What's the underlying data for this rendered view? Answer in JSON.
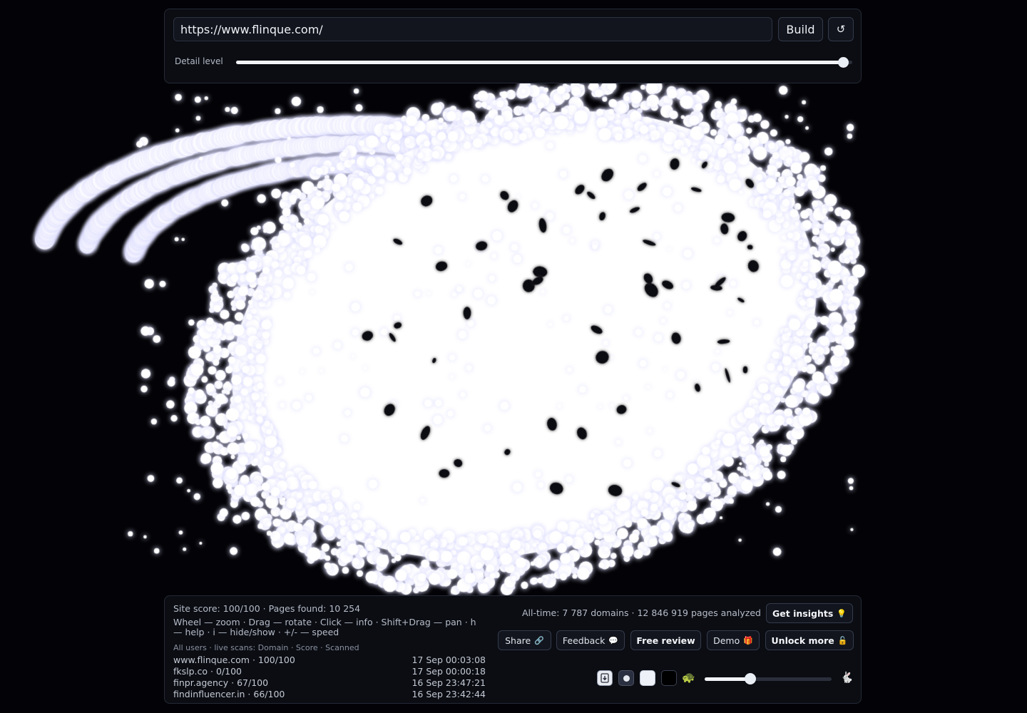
{
  "builder": {
    "url_value": "https://www.flinque.com/",
    "build_label": "Build",
    "reset_symbol": "↺",
    "detail_label": "Detail level",
    "detail_level": 0.985
  },
  "stats": {
    "site_score_line": "Site score: 100/100 · Pages found: 10 254",
    "help_text": "Wheel — zoom · Drag — rotate · Click — info · Shift+Drag — pan · h — help · i — hide/show · +/- — speed",
    "alltime_text": "All-time: 7 787 domains · 12 846 919 pages analyzed",
    "scans_header": "All users · live scans: Domain · Score · Scanned",
    "scans": [
      {
        "domain": "www.flinque.com · 100/100",
        "time": "17 Sep 00:03:08"
      },
      {
        "domain": "fkslp.co · 0/100",
        "time": "17 Sep 00:00:18"
      },
      {
        "domain": "finpr.agency · 67/100",
        "time": "16 Sep 23:47:21"
      },
      {
        "domain": "findinfluencer.in · 66/100",
        "time": "16 Sep 23:42:44"
      }
    ]
  },
  "actions": {
    "insights_label": "Get insights",
    "insights_emoji": "💡",
    "share_label": "Share",
    "share_emoji": "🔗",
    "feedback_label": "Feedback",
    "feedback_emoji": "💬",
    "free_review_label": "Free review",
    "demo_label": "Demo",
    "demo_emoji": "🎁",
    "unlock_label": "Unlock more",
    "unlock_emoji": "🔓"
  },
  "controls": {
    "turtle_glyph": "🐢",
    "rabbit_glyph": "🐇",
    "speed_level": 0.36,
    "icons": [
      "download-icon",
      "dot-icon",
      "white-bg-swatch",
      "black-bg-swatch",
      "turtle-icon",
      "rabbit-icon"
    ]
  },
  "visualization": {
    "background": "#030307",
    "point_color": "#ffffff",
    "glow_color": "#dcdcff"
  }
}
